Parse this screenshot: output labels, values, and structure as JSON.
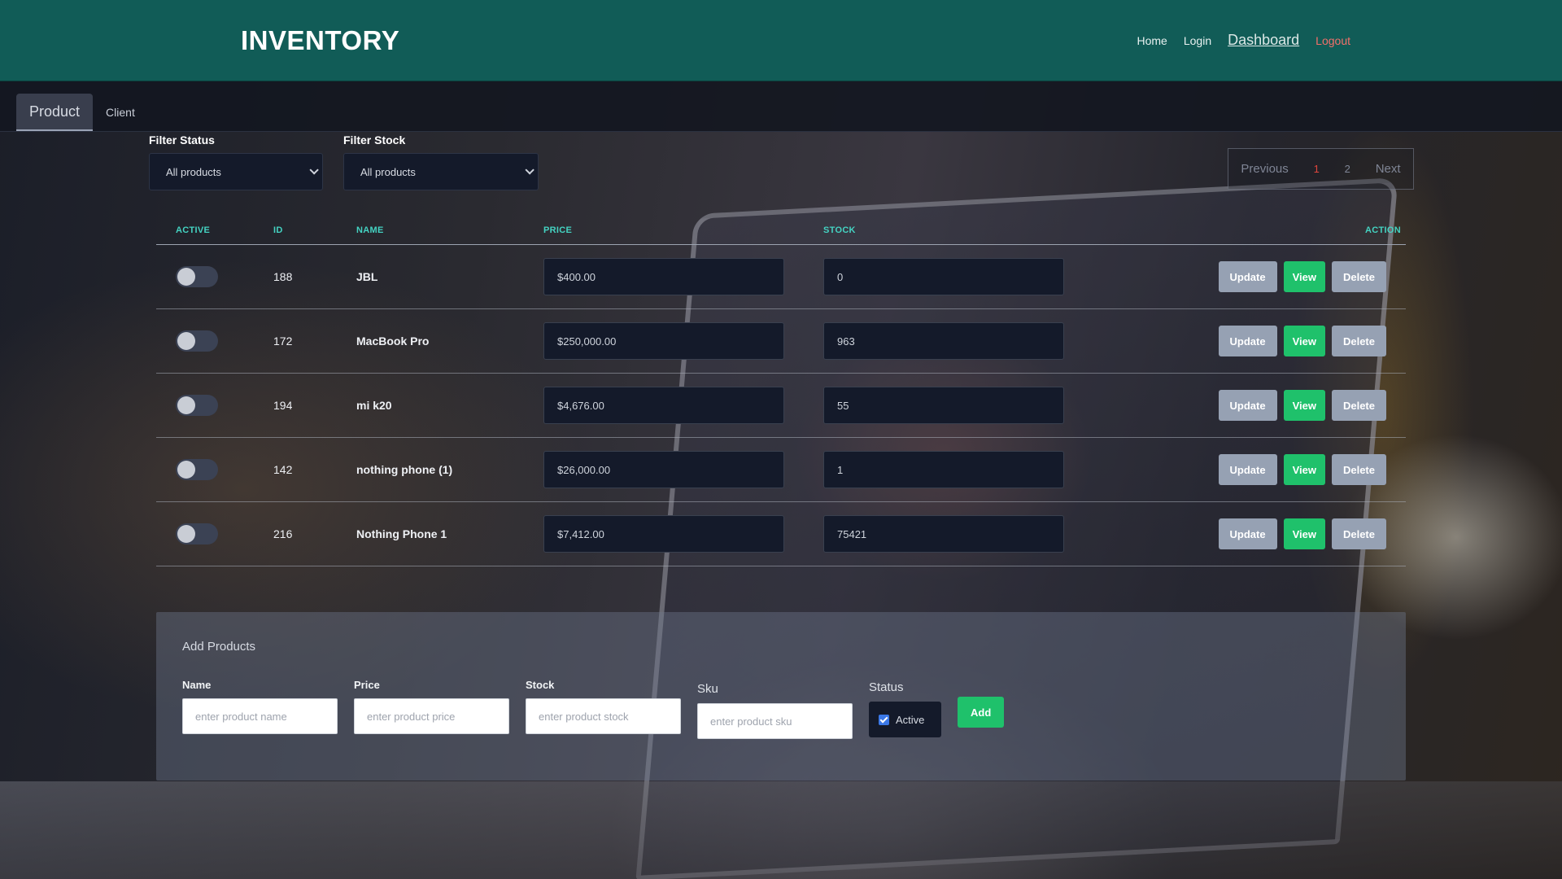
{
  "header": {
    "brand": "INVENTORY",
    "nav": {
      "home": "Home",
      "login": "Login",
      "dashboard": "Dashboard",
      "logout": "Logout"
    }
  },
  "tabs": [
    {
      "label": "Product",
      "active": true
    },
    {
      "label": "Client",
      "active": false
    }
  ],
  "filters": {
    "status_label": "Filter Status",
    "status_value": "All products",
    "stock_label": "Filter Stock",
    "stock_value": "All products"
  },
  "pagination": {
    "previous": "Previous",
    "page1": "1",
    "page2": "2",
    "next": "Next",
    "current": 1
  },
  "table": {
    "headers": {
      "active": "ACTIVE",
      "id": "ID",
      "name": "NAME",
      "price": "PRICE",
      "stock": "STOCK",
      "action": "ACTION"
    },
    "rows": [
      {
        "id": "188",
        "name": "JBL",
        "price": "$400.00",
        "stock": "0",
        "active": false
      },
      {
        "id": "172",
        "name": "MacBook Pro",
        "price": "$250,000.00",
        "stock": "963",
        "active": false
      },
      {
        "id": "194",
        "name": "mi k20",
        "price": "$4,676.00",
        "stock": "55",
        "active": false
      },
      {
        "id": "142",
        "name": "nothing phone (1)",
        "price": "$26,000.00",
        "stock": "1",
        "active": false
      },
      {
        "id": "216",
        "name": "Nothing Phone 1",
        "price": "$7,412.00",
        "stock": "75421",
        "active": false
      }
    ],
    "actions": {
      "update": "Update",
      "view": "View",
      "delete": "Delete"
    }
  },
  "add_products": {
    "title": "Add Products",
    "name_label": "Name",
    "name_placeholder": "enter product name",
    "price_label": "Price",
    "price_placeholder": "enter product price",
    "stock_label": "Stock",
    "stock_placeholder": "enter product stock",
    "sku_label": "Sku",
    "sku_placeholder": "enter product sku",
    "status_label": "Status",
    "status_checkbox": "Active",
    "status_checked": true,
    "add_button": "Add"
  },
  "colors": {
    "header_bg": "#115c57",
    "accent_teal": "#44d3c2",
    "view_green": "#1fc16b",
    "neutral_button": "#96a1b3",
    "logout_red": "#f2706a"
  }
}
